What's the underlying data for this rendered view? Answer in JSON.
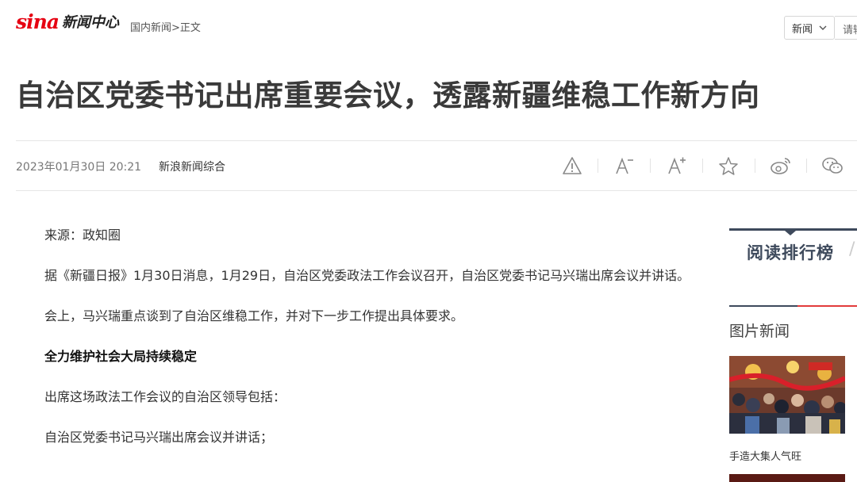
{
  "header": {
    "logo_text": "sina",
    "logo_center": "新闻中心",
    "breadcrumb": {
      "section": "国内新闻",
      "sep": ">",
      "current": "正文"
    },
    "channel_select": "新闻",
    "search_placeholder": "请输入关键词"
  },
  "article": {
    "title": "自治区党委书记出席重要会议，透露新疆维稳工作新方向",
    "date": "2023年01月30日 20:21",
    "source": "新浪新闻综合",
    "paragraphs": [
      {
        "text": "来源：政知圈",
        "bold": false
      },
      {
        "text": "据《新疆日报》1月30日消息，1月29日，自治区党委政法工作会议召开，自治区党委书记马兴瑞出席会议并讲话。",
        "bold": false
      },
      {
        "text": "会上，马兴瑞重点谈到了自治区维稳工作，并对下一步工作提出具体要求。",
        "bold": false
      },
      {
        "text": "全力维护社会大局持续稳定",
        "bold": true
      },
      {
        "text": "出席这场政法工作会议的自治区领导包括：",
        "bold": false
      },
      {
        "text": "自治区党委书记马兴瑞出席会议并讲话；",
        "bold": false
      }
    ]
  },
  "toolbar": {
    "icons": [
      "report-icon",
      "font-decrease-icon",
      "font-increase-icon",
      "favorite-icon",
      "weibo-share-icon",
      "wechat-share-icon"
    ]
  },
  "sidebar": {
    "rank_title": "阅读排行榜",
    "picture_news_heading": "图片新闻",
    "picture_caption": "手造大集人气旺"
  },
  "colors": {
    "brand_red": "#e60012",
    "rank_accent": "#3e4a5c",
    "rank_red": "#e23b3b"
  }
}
